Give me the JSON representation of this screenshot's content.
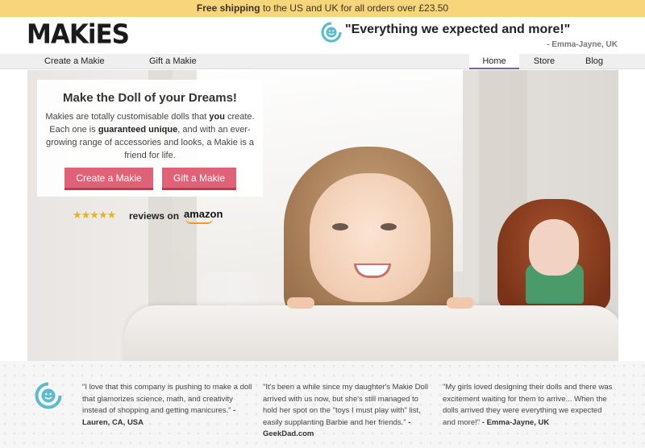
{
  "promo": {
    "bold": "Free shipping",
    "rest": " to the US and UK for all orders over £23.50"
  },
  "header": {
    "logo": "MAKiES",
    "quote": "\"Everything we expected and more!\"",
    "quote_author": "- Emma-Jayne, UK"
  },
  "nav": {
    "left": [
      {
        "label": "Create a Makie"
      },
      {
        "label": "Gift a Makie"
      }
    ],
    "right": [
      {
        "label": "Home",
        "active": true
      },
      {
        "label": "Store",
        "active": false
      },
      {
        "label": "Blog",
        "active": false
      }
    ]
  },
  "hero": {
    "title": "Make the Doll of your Dreams!",
    "desc_1": "Makies are totally customisable dolls that ",
    "desc_bold_1": "you",
    "desc_2": " create. Each one is ",
    "desc_bold_2": "guaranteed unique",
    "desc_3": ", and with an ever-growing range of accessories and looks, a Makie is a friend for life.",
    "cta_create": "Create a Makie",
    "cta_gift": "Gift a Makie",
    "stars": "★★★★★",
    "rating_stars": 5,
    "reviews_label": "reviews on",
    "amazon": "amazon"
  },
  "testimonials": [
    {
      "text": "\"I love that this company is pushing to make a doll that glamorizes science, math, and creativity instead of shopping and getting manicures.\"",
      "author": "- Lauren, CA, USA"
    },
    {
      "text": "\"It's been a while since my daughter's Makie Doll arrived with us now, but she's still managed to hold her spot on the \"toys I must play with\" list, easily supplanting Barbie and her friends.\"",
      "author": "- GeekDad.com"
    },
    {
      "text": "\"My girls loved designing their dolls and there was excitement waiting for them to arrive... When the dolls arrived they were everything we expected and more!\"",
      "author": "- Emma-Jayne, UK"
    }
  ],
  "colors": {
    "promo_bg": "#f7d57a",
    "cta": "#e06276",
    "nav_active": "#7c5fa8",
    "smile_icon": "#5bbcd0",
    "stars": "#e8b321"
  },
  "icons": {
    "quote": "smile-icon",
    "testimonials": "smile-icon"
  }
}
